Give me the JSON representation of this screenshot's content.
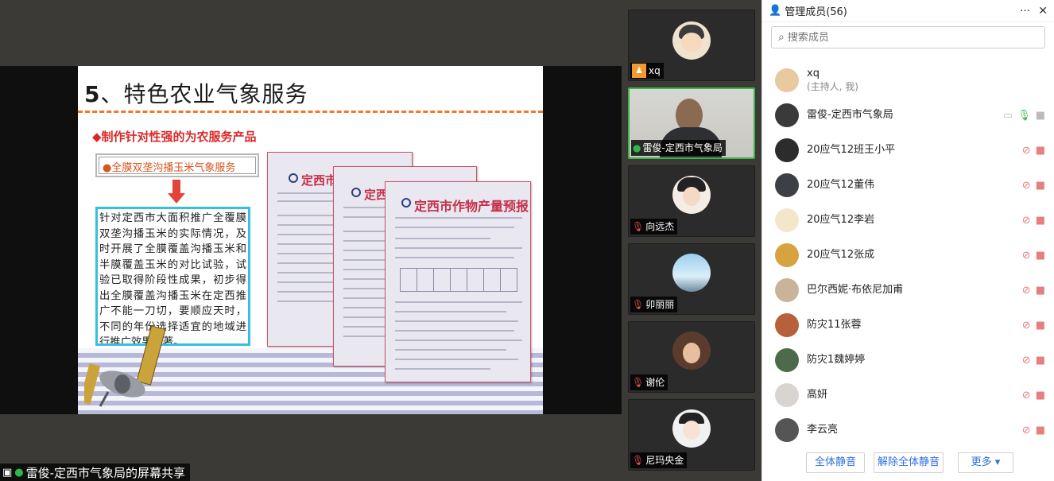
{
  "slide": {
    "title_num": "5",
    "title_text": "、特色农业气象服务",
    "subhead": "◆制作针对性强的为农服务产品",
    "tag": "●全膜双垄沟播玉米气象服务",
    "body": "针对定西市大面积推广全覆膜双垄沟播玉米的实际情况，及时开展了全膜覆盖沟播玉米和半膜覆盖玉米的对比试验，试验已取得阶段性成果，初步得出全膜覆盖沟播玉米在定西推广不能一刀切，要顺应天时，不同的年份选择适宜的地域进行推广效果显著。",
    "doc1_title": "定西市",
    "doc2_title": "定西市",
    "doc3_title": "定西市作物产量预报"
  },
  "share_bar": {
    "label": "雷俊-定西市气象局的屏幕共享"
  },
  "videos": [
    {
      "name": "xq",
      "muted": false,
      "host": true
    },
    {
      "name": "雷俊-定西市气象局",
      "muted": false,
      "active": true
    },
    {
      "name": "向远杰",
      "muted": true
    },
    {
      "name": "卯丽丽",
      "muted": true
    },
    {
      "name": "谢伦",
      "muted": true
    },
    {
      "name": "尼玛央金",
      "muted": true
    }
  ],
  "panel": {
    "title": "管理成员(56)",
    "more": "···",
    "close": "✕",
    "search_placeholder": "搜索成员",
    "members": [
      {
        "name": "xq",
        "sub": "(主持人, 我)",
        "icons": "none",
        "avatar": "#e8c9a0"
      },
      {
        "name": "雷俊-定西市气象局",
        "icons": "active",
        "avatar": "#3a3a3a"
      },
      {
        "name": "20应气12班王小平",
        "icons": "muted",
        "avatar": "#2c2c2c"
      },
      {
        "name": "20应气12董伟",
        "icons": "muted",
        "avatar": "#3d3f46"
      },
      {
        "name": "20应气12李岩",
        "icons": "muted",
        "avatar": "#f4e7c9"
      },
      {
        "name": "20应气12张成",
        "icons": "muted",
        "avatar": "#d7a33e"
      },
      {
        "name": "巴尔西妮·布依尼加甫",
        "icons": "muted",
        "avatar": "#c9b49a"
      },
      {
        "name": "防灾11张蓉",
        "icons": "muted",
        "avatar": "#b7603c"
      },
      {
        "name": "防灾1魏婷婷",
        "icons": "muted",
        "avatar": "#4d6b4a"
      },
      {
        "name": "高妍",
        "icons": "muted",
        "avatar": "#d8d4d0"
      },
      {
        "name": "李云亮",
        "icons": "muted",
        "avatar": "#555555"
      }
    ],
    "footer": {
      "mute_all": "全体静音",
      "unmute_all": "解除全体静音",
      "more": "更多 ▾"
    }
  }
}
